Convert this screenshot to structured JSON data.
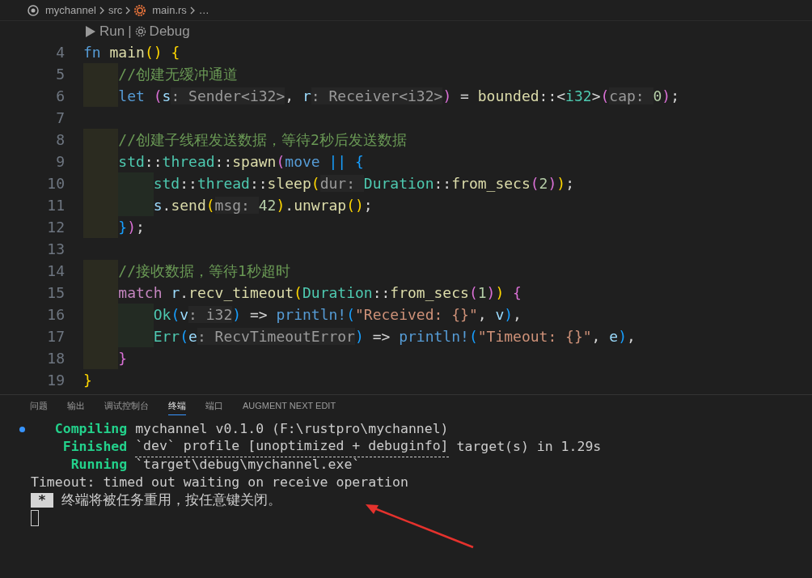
{
  "breadcrumb": [
    {
      "label": "mychannel",
      "kind": "repo"
    },
    {
      "label": "src",
      "kind": "folder"
    },
    {
      "label": "main.rs",
      "kind": "rust"
    },
    {
      "label": "…",
      "kind": "more"
    }
  ],
  "codelens": [
    {
      "label": "Run",
      "kind": "run"
    },
    {
      "label": "Debug",
      "kind": "debug"
    }
  ],
  "codelens_separator": "|",
  "code_lines": [
    {
      "number": "4",
      "tokens": [
        {
          "text": "fn ",
          "kind": "k"
        },
        {
          "text": "main",
          "kind": "f"
        },
        {
          "text": "() ",
          "kind": "b1"
        },
        {
          "text": "{",
          "kind": "b1"
        }
      ],
      "children": [
        {
          "number": "5",
          "tokens": [
            {
              "text": "//创建无缓冲通道",
              "kind": "c"
            }
          ]
        },
        {
          "number": "6",
          "tokens": [
            {
              "text": "let ",
              "kind": "k"
            },
            {
              "text": "(",
              "kind": "b2"
            },
            {
              "text": "s",
              "kind": "v"
            },
            {
              "text": ": Sender<i32>",
              "kind": "h"
            },
            {
              "text": ", ",
              "kind": "p"
            },
            {
              "text": "r",
              "kind": "v"
            },
            {
              "text": ": Receiver<i32>",
              "kind": "h"
            },
            {
              "text": ")",
              "kind": "b2"
            },
            {
              "text": " = ",
              "kind": "p"
            },
            {
              "text": "bounded",
              "kind": "f"
            },
            {
              "text": "::<",
              "kind": "p"
            },
            {
              "text": "i32",
              "kind": "t"
            },
            {
              "text": ">",
              "kind": "p"
            },
            {
              "text": "(",
              "kind": "b2"
            },
            {
              "text": "cap: ",
              "kind": "h"
            },
            {
              "text": "0",
              "kind": "n"
            },
            {
              "text": ")",
              "kind": "b2"
            },
            {
              "text": ";",
              "kind": "p"
            }
          ]
        },
        {
          "number": "7"
        },
        {
          "number": "8",
          "tokens": [
            {
              "text": "//创建子线程发送数据，等待2秒后发送数据",
              "kind": "c"
            }
          ]
        },
        {
          "number": "9",
          "tokens": [
            {
              "text": "std",
              "kind": "t"
            },
            {
              "text": "::",
              "kind": "p"
            },
            {
              "text": "thread",
              "kind": "t"
            },
            {
              "text": "::",
              "kind": "p"
            },
            {
              "text": "spawn",
              "kind": "f"
            },
            {
              "text": "(",
              "kind": "b2"
            },
            {
              "text": "move ",
              "kind": "k"
            },
            {
              "text": "|| ",
              "kind": "b3"
            },
            {
              "text": "{",
              "kind": "b3"
            }
          ],
          "children": [
            {
              "number": "10",
              "tokens": [
                {
                  "text": "std",
                  "kind": "t"
                },
                {
                  "text": "::",
                  "kind": "p"
                },
                {
                  "text": "thread",
                  "kind": "t"
                },
                {
                  "text": "::",
                  "kind": "p"
                },
                {
                  "text": "sleep",
                  "kind": "f"
                },
                {
                  "text": "(",
                  "kind": "b1"
                },
                {
                  "text": "dur: ",
                  "kind": "h"
                },
                {
                  "text": "Duration",
                  "kind": "t"
                },
                {
                  "text": "::",
                  "kind": "p"
                },
                {
                  "text": "from_secs",
                  "kind": "f"
                },
                {
                  "text": "(",
                  "kind": "b2"
                },
                {
                  "text": "2",
                  "kind": "n"
                },
                {
                  "text": ")",
                  "kind": "b2"
                },
                {
                  "text": ")",
                  "kind": "b1"
                },
                {
                  "text": ";",
                  "kind": "p"
                }
              ]
            },
            {
              "number": "11",
              "tokens": [
                {
                  "text": "s",
                  "kind": "v"
                },
                {
                  "text": ".",
                  "kind": "p"
                },
                {
                  "text": "send",
                  "kind": "f"
                },
                {
                  "text": "(",
                  "kind": "b1"
                },
                {
                  "text": "msg: ",
                  "kind": "h"
                },
                {
                  "text": "42",
                  "kind": "n"
                },
                {
                  "text": ")",
                  "kind": "b1"
                },
                {
                  "text": ".",
                  "kind": "p"
                },
                {
                  "text": "unwrap",
                  "kind": "f"
                },
                {
                  "text": "()",
                  "kind": "b1"
                },
                {
                  "text": ";",
                  "kind": "p"
                }
              ]
            }
          ]
        },
        {
          "number": "12",
          "tokens": [
            {
              "text": "}",
              "kind": "b3"
            },
            {
              "text": ")",
              "kind": "b2"
            },
            {
              "text": ";",
              "kind": "p"
            }
          ]
        },
        {
          "number": "13"
        },
        {
          "number": "14",
          "tokens": [
            {
              "text": "//接收数据，等待1秒超时",
              "kind": "c"
            }
          ]
        },
        {
          "number": "15",
          "tokens": [
            {
              "text": "match ",
              "kind": "m"
            },
            {
              "text": "r",
              "kind": "v"
            },
            {
              "text": ".",
              "kind": "p"
            },
            {
              "text": "recv_timeout",
              "kind": "f"
            },
            {
              "text": "(",
              "kind": "b1"
            },
            {
              "text": "Duration",
              "kind": "t"
            },
            {
              "text": "::",
              "kind": "p"
            },
            {
              "text": "from_secs",
              "kind": "f"
            },
            {
              "text": "(",
              "kind": "b2"
            },
            {
              "text": "1",
              "kind": "n"
            },
            {
              "text": ")",
              "kind": "b2"
            },
            {
              "text": ") ",
              "kind": "b1"
            },
            {
              "text": "{",
              "kind": "b2"
            }
          ],
          "children": [
            {
              "number": "16",
              "tokens": [
                {
                  "text": "Ok",
                  "kind": "t"
                },
                {
                  "text": "(",
                  "kind": "b3"
                },
                {
                  "text": "v",
                  "kind": "v"
                },
                {
                  "text": ": i32",
                  "kind": "h"
                },
                {
                  "text": ")",
                  "kind": "b3"
                },
                {
                  "text": " => ",
                  "kind": "p"
                },
                {
                  "text": "println!",
                  "kind": "k"
                },
                {
                  "text": "(",
                  "kind": "b3"
                },
                {
                  "text": "\"Received: {}\"",
                  "kind": "s"
                },
                {
                  "text": ", ",
                  "kind": "p"
                },
                {
                  "text": "v",
                  "kind": "v"
                },
                {
                  "text": ")",
                  "kind": "b3"
                },
                {
                  "text": ",",
                  "kind": "p"
                }
              ]
            },
            {
              "number": "17",
              "tokens": [
                {
                  "text": "Err",
                  "kind": "t"
                },
                {
                  "text": "(",
                  "kind": "b3"
                },
                {
                  "text": "e",
                  "kind": "v"
                },
                {
                  "text": ": RecvTimeoutError",
                  "kind": "h"
                },
                {
                  "text": ")",
                  "kind": "b3"
                },
                {
                  "text": " => ",
                  "kind": "p"
                },
                {
                  "text": "println!",
                  "kind": "k"
                },
                {
                  "text": "(",
                  "kind": "b3"
                },
                {
                  "text": "\"Timeout: {}\"",
                  "kind": "s"
                },
                {
                  "text": ", ",
                  "kind": "p"
                },
                {
                  "text": "e",
                  "kind": "v"
                },
                {
                  "text": ")",
                  "kind": "b3"
                },
                {
                  "text": ",",
                  "kind": "p"
                }
              ]
            }
          ]
        },
        {
          "number": "18",
          "tokens": [
            {
              "text": "}",
              "kind": "b2"
            }
          ]
        }
      ]
    },
    {
      "number": "19",
      "tokens": [
        {
          "text": "}",
          "kind": "b1"
        }
      ]
    }
  ],
  "panel_tabs": [
    {
      "label": "问题",
      "selected": false
    },
    {
      "label": "输出",
      "selected": false
    },
    {
      "label": "调试控制台",
      "selected": false
    },
    {
      "label": "终端",
      "selected": true
    },
    {
      "label": "端口",
      "selected": false
    },
    {
      "label": "AUGMENT NEXT EDIT",
      "selected": false
    }
  ],
  "terminal": [
    {
      "kind": "cargo",
      "dot": true,
      "status": "Compiling",
      "text": "mychannel v0.1.0 (F:\\rustpro\\mychannel)"
    },
    {
      "kind": "cargo",
      "dot": false,
      "status": "Finished",
      "link": "`dev` profile [unoptimized + debuginfo]",
      "text": " target(s) in 1.29s"
    },
    {
      "kind": "cargo",
      "dot": false,
      "status": "Running",
      "text": "`target\\debug\\mychannel.exe`"
    },
    {
      "kind": "plain",
      "text": "Timeout: timed out waiting on receive operation"
    },
    {
      "kind": "task",
      "badge": "*",
      "text": "终端将被任务重用，按任意键关闭。"
    },
    {
      "kind": "cursor"
    }
  ]
}
